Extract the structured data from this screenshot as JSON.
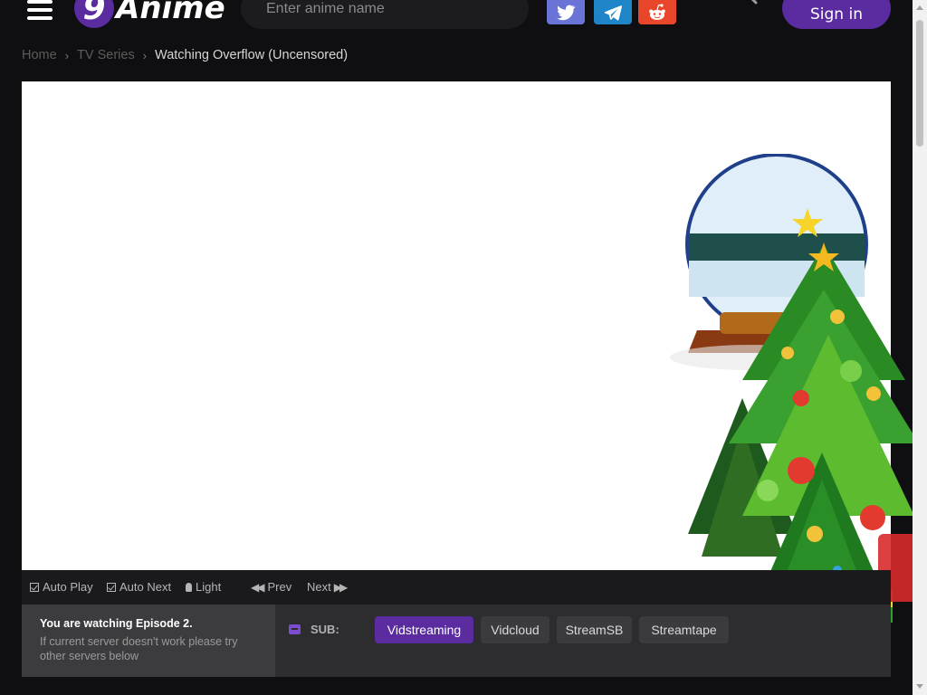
{
  "header": {
    "logo_badge": "9",
    "logo_text": "Anime",
    "search_placeholder": "Enter anime name",
    "signin_label": "Sign in",
    "social_icons": [
      "twitter-icon",
      "telegram-icon",
      "reddit-icon"
    ]
  },
  "breadcrumb": {
    "items": [
      "Home",
      "TV Series"
    ],
    "current": "Watching Overflow (Uncensored)"
  },
  "player_controls": {
    "auto_play": "Auto Play",
    "auto_next": "Auto Next",
    "light": "Light",
    "prev": "Prev",
    "next": "Next"
  },
  "servers": {
    "notice_title": "You are watching Episode 2.",
    "notice_text": "If current server doesn't work please try other servers below",
    "sub_label": "SUB:",
    "list": [
      "Vidstreaming",
      "Vidcloud",
      "StreamSB",
      "Streamtape"
    ],
    "active": "Vidstreaming"
  },
  "colors": {
    "accent": "#5a2ca0",
    "background": "#0f0f11",
    "twitter": "#6a74d6",
    "telegram": "#1e86c8",
    "reddit": "#e8462a"
  }
}
